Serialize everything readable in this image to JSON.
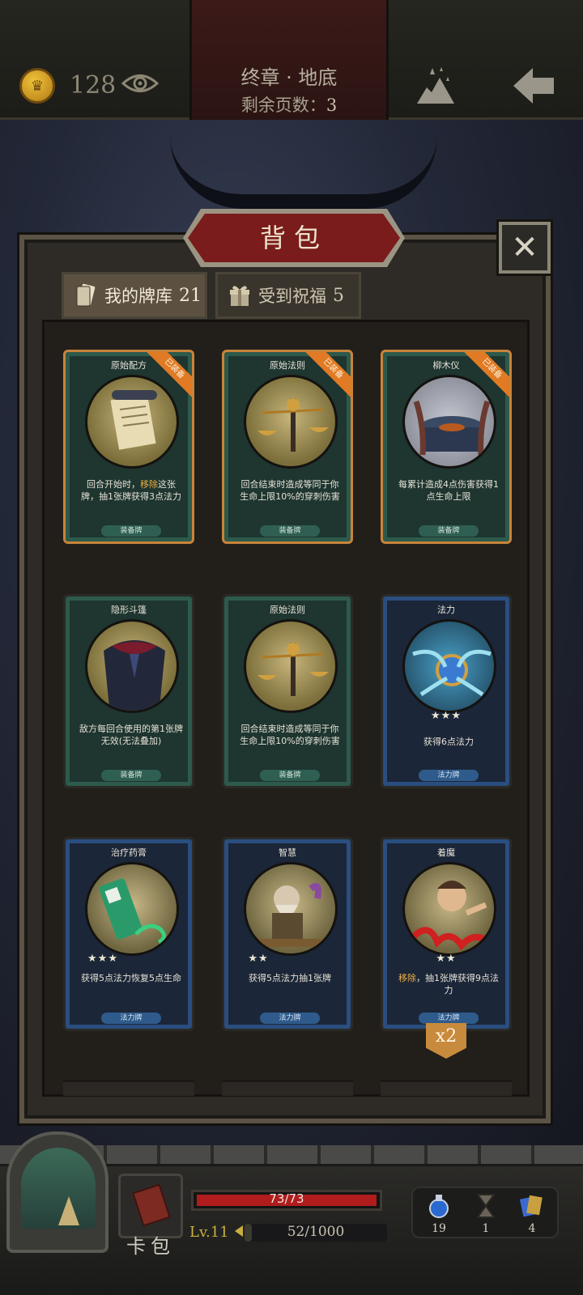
{
  "header": {
    "gold": "128",
    "chapter": "终章 · 地底",
    "pages_label": "剩余页数：",
    "pages_value": "3"
  },
  "panel": {
    "title": "背包",
    "tabs": [
      {
        "label": "我的牌库",
        "count": "21",
        "icon": "cards-icon"
      },
      {
        "label": "受到祝福",
        "count": "5",
        "icon": "gift-icon"
      }
    ]
  },
  "cards": [
    {
      "name": "原始配方",
      "type": "装备牌",
      "equipped": "已装备",
      "text_a": "回合开始时，",
      "hl": "移除",
      "text_b": "这张牌，抽1张牌获得3点法力",
      "stars": "",
      "art": "scroll"
    },
    {
      "name": "原始法则",
      "type": "装备牌",
      "equipped": "已装备",
      "text": "回合结束时造成等同于你生命上限10%的穿刺伤害",
      "stars": "",
      "art": "scales"
    },
    {
      "name": "柳木仪",
      "type": "装备牌",
      "equipped": "已装备",
      "text": "每累计造成4点伤害获得1点生命上限",
      "stars": "",
      "art": "altar"
    },
    {
      "name": "隐形斗篷",
      "type": "装备牌",
      "equipped": "",
      "text": "敌方每回合使用的第1张牌无效(无法叠加)",
      "stars": "",
      "art": "cloak"
    },
    {
      "name": "原始法则",
      "type": "装备牌",
      "equipped": "",
      "text": "回合结束时造成等同于你生命上限10%的穿刺伤害",
      "stars": "",
      "art": "scales"
    },
    {
      "name": "法力",
      "type": "法力牌",
      "equipped": "",
      "text": "获得6点法力",
      "stars": "★★★",
      "art": "orb"
    },
    {
      "name": "治疗药膏",
      "type": "法力牌",
      "equipped": "",
      "text": "获得5点法力恢复5点生命",
      "stars": "★★★",
      "art": "tube"
    },
    {
      "name": "智慧",
      "type": "法力牌",
      "equipped": "",
      "text": "获得5点法力抽1张牌",
      "stars": "★★",
      "art": "sage"
    },
    {
      "name": "着魔",
      "type": "法力牌",
      "equipped": "",
      "hl": "移除",
      "text_b": "，抽1张牌获得9点法力",
      "stars": "★★",
      "art": "mad"
    }
  ],
  "multiplier": "x2",
  "footer": {
    "hp": "73/73",
    "hp_fraction": 1.0,
    "level": "Lv.11",
    "xp": "52/1000",
    "xp_fraction": 0.052,
    "deck_button": "卡包",
    "resources": [
      {
        "icon": "potion-icon",
        "value": "19"
      },
      {
        "icon": "hourglass-icon",
        "value": "1"
      },
      {
        "icon": "cards-icon",
        "value": "4"
      }
    ]
  },
  "colors": {
    "accent_red": "#7a1c1c",
    "equip_green": "#2d5a4c",
    "mana_blue": "#2a4e80",
    "equipped_ribbon": "#e07a24",
    "highlight": "#f0b040"
  }
}
